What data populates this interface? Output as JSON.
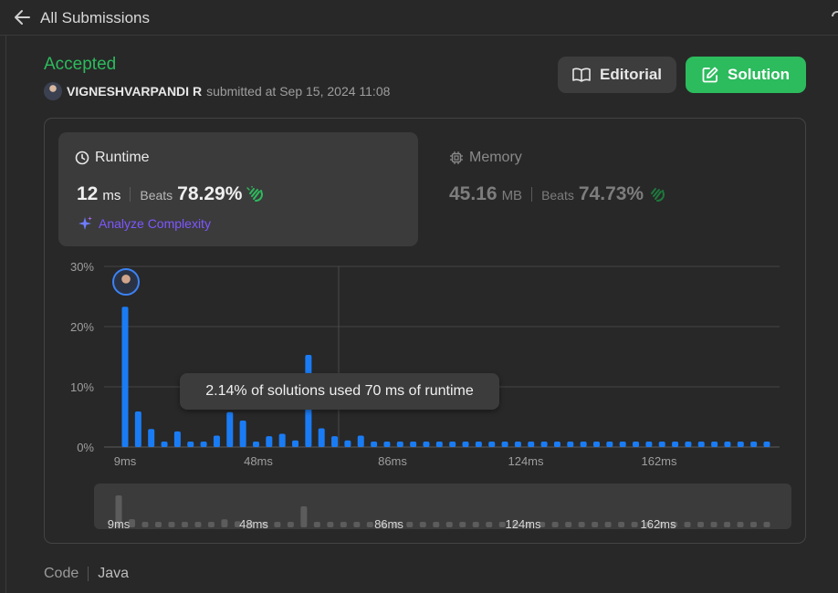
{
  "header": {
    "back_label": "All Submissions"
  },
  "submission": {
    "status": "Accepted",
    "user": "VIGNESHVARPANDI R",
    "submitted_text": "submitted at Sep 15, 2024 11:08"
  },
  "buttons": {
    "editorial": "Editorial",
    "solution": "Solution"
  },
  "runtime": {
    "title": "Runtime",
    "value": "12",
    "unit": "ms",
    "beats_label": "Beats",
    "beats": "78.29%"
  },
  "memory": {
    "title": "Memory",
    "value": "45.16",
    "unit": "MB",
    "beats_label": "Beats",
    "beats": "74.73%"
  },
  "analyze_label": "Analyze Complexity",
  "tooltip": "2.14% of solutions used 70 ms of runtime",
  "code": {
    "label": "Code",
    "language": "Java"
  },
  "colors": {
    "accent_green": "#2cbb5d",
    "bar_blue": "#1a7cf5",
    "purple": "#7e57ff"
  },
  "chart_data": {
    "type": "bar",
    "ylabel_ticks": [
      "0%",
      "10%",
      "20%",
      "30%"
    ],
    "ylim": [
      0,
      30
    ],
    "xtick_labels": [
      "9ms",
      "48ms",
      "86ms",
      "124ms",
      "162ms"
    ],
    "values": [
      23.3,
      5.9,
      3.0,
      0.9,
      2.6,
      0.9,
      0.9,
      1.9,
      5.8,
      4.4,
      0.9,
      1.8,
      2.2,
      1.1,
      15.3,
      3.1,
      1.8,
      1.1,
      1.9,
      0.9,
      0.9,
      0.9,
      0.9,
      0.9,
      0.9,
      0.9,
      0.9,
      0.9,
      0.9,
      0.9,
      0.9,
      0.9,
      0.9,
      0.9,
      0.9,
      0.9,
      0.9,
      0.9,
      0.9,
      0.9,
      0.9,
      0.9,
      0.9,
      0.9,
      0.9,
      0.9,
      0.9,
      0.9,
      0.9,
      0.9
    ],
    "highlight_index": 0,
    "grid": true,
    "series_color": "#1a7cf5"
  }
}
